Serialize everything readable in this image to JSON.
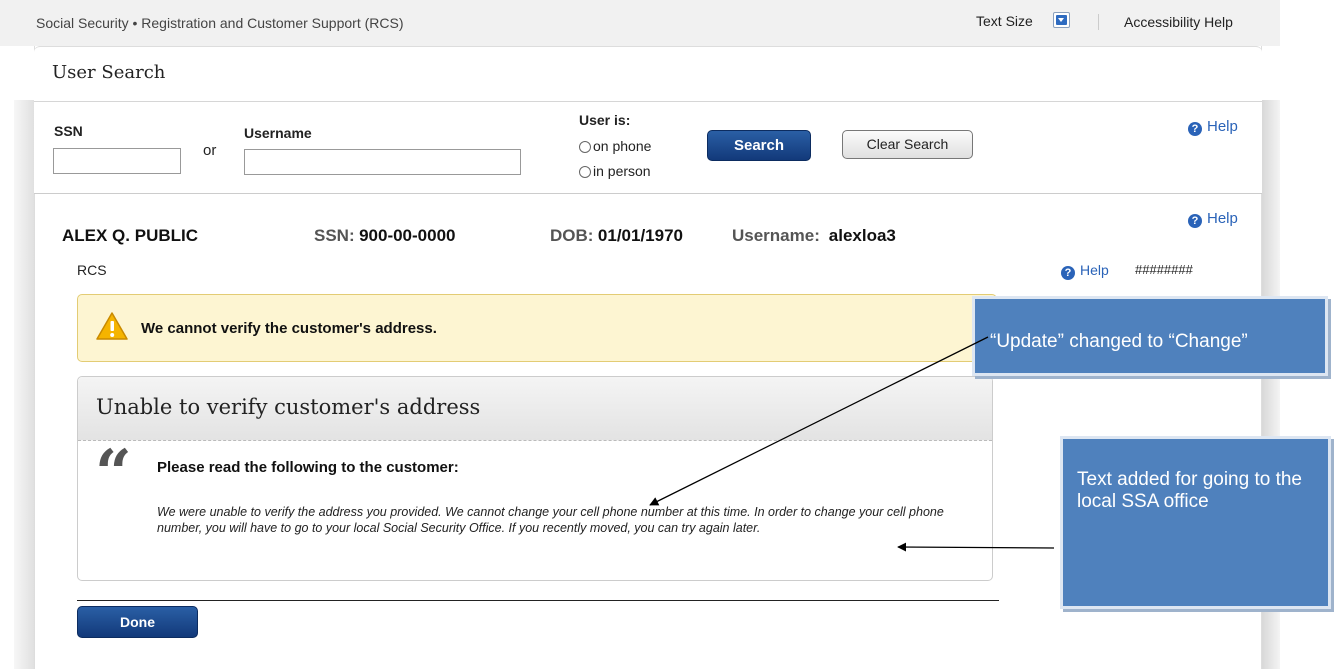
{
  "header": {
    "app_title": "Social Security • Registration and Customer Support (RCS)",
    "text_size_label": "Text Size",
    "accessibility_help": "Accessibility Help"
  },
  "search": {
    "title": "User Search",
    "ssn_label": "SSN",
    "or_label": "or",
    "username_label": "Username",
    "ssn_value": "",
    "username_value": "",
    "user_is_label": "User is:",
    "radio_on_phone": "on phone",
    "radio_in_person": "in person",
    "search_button": "Search",
    "clear_button": "Clear Search",
    "help_label": "Help"
  },
  "user": {
    "name": "ALEX Q. PUBLIC",
    "ssn_label": "SSN:",
    "ssn": "900-00-0000",
    "dob_label": "DOB:",
    "dob": "01/01/1970",
    "username_label": "Username:",
    "username": "alexloa3",
    "help_label": "Help"
  },
  "rcs": {
    "label": "RCS",
    "help_label": "Help",
    "code": "########"
  },
  "alert": {
    "message": "We cannot verify the customer's address."
  },
  "script": {
    "title": "Unable to verify customer's address",
    "instruction": "Please read the following to the customer:",
    "body": "We were unable to verify the address you provided. We cannot change your cell phone number at this time. In order to change your cell phone number, you will have to go to your local Social Security Office. If you recently moved, you can try again later."
  },
  "actions": {
    "done_button": "Done"
  },
  "annotations": {
    "callout_change": "“Update” changed to “Change”",
    "callout_text_added": "Text added for going to the local SSA office"
  },
  "colors": {
    "primary_blue": "#12397a",
    "help_blue": "#2a63b8",
    "alert_bg": "#fdf5d2",
    "callout_blue": "#4f81bd"
  }
}
